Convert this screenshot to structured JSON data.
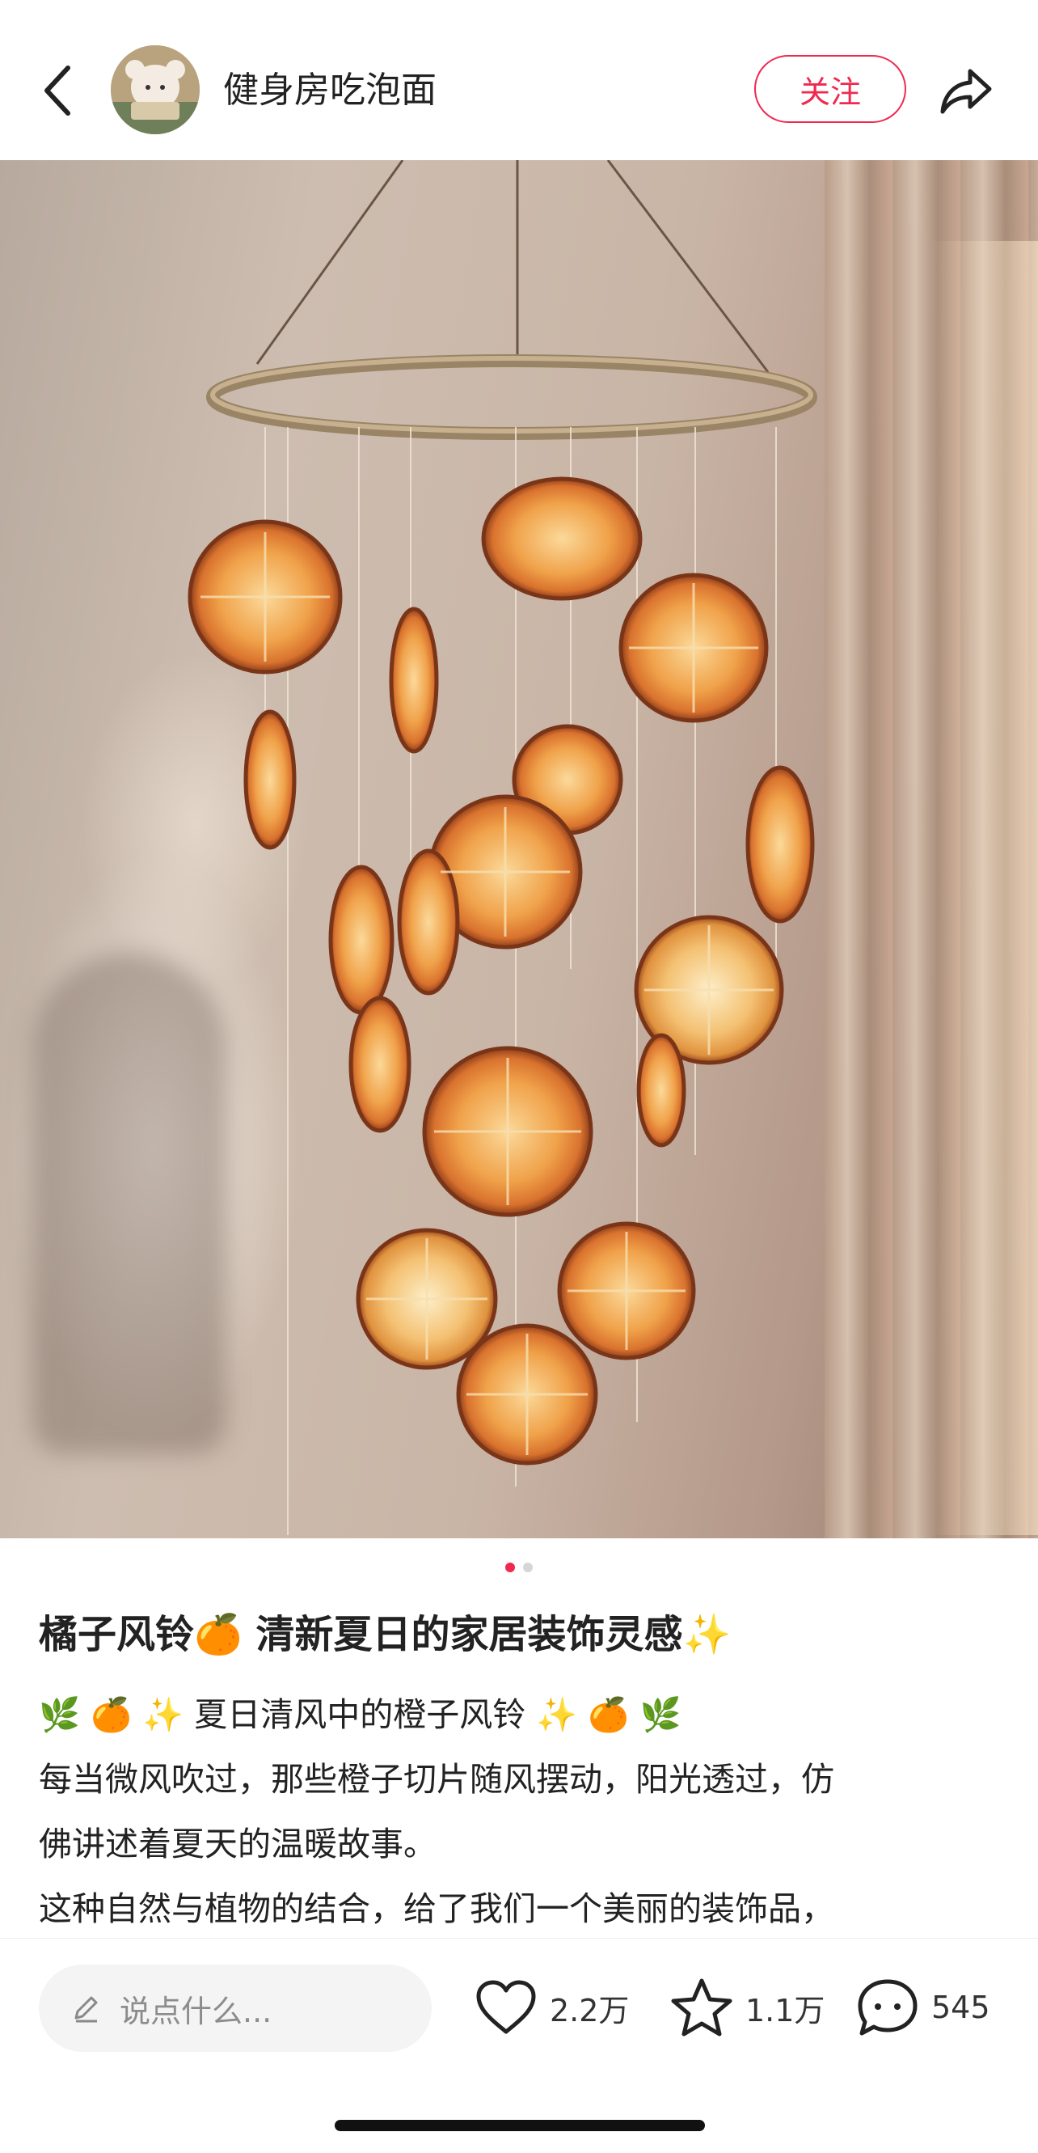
{
  "header": {
    "username": "健身房吃泡面",
    "follow_label": "关注",
    "back_icon": "chevron-left-icon",
    "share_icon": "share-arrow-icon",
    "accent_color": "#f0294f"
  },
  "carousel": {
    "image_count": 2,
    "active_index": 0
  },
  "post": {
    "title": "橘子风铃🍊 清新夏日的家居装饰灵感✨",
    "lines": [
      "🌿 🍊 ✨ 夏日清风中的橙子风铃 ✨ 🍊 🌿",
      "每当微风吹过，那些橙子切片随风摆动，阳光透过，仿",
      "佛讲述着夏天的温暖故事。",
      "这种自然与植物的结合，给了我们一个美丽的装饰品，"
    ]
  },
  "bottom_bar": {
    "comment_placeholder": "说点什么...",
    "likes": "2.2万",
    "favorites": "1.1万",
    "comments": "545"
  }
}
